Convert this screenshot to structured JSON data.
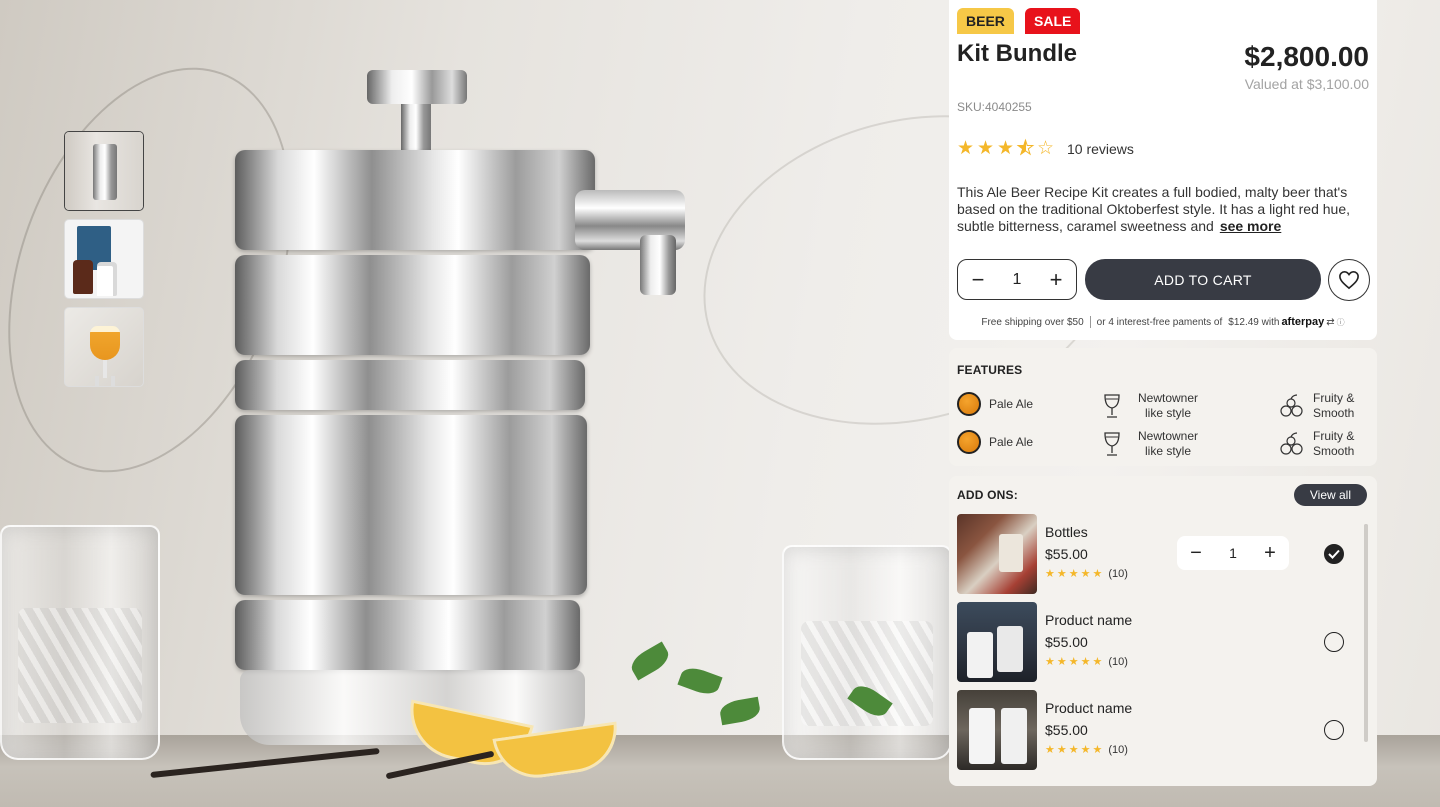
{
  "product": {
    "badges": [
      "BEER",
      "SALE"
    ],
    "title": "Kit Bundle",
    "price": "$2,800.00",
    "valued": "Valued at $3,100.00",
    "sku": "SKU:4040255",
    "rating_value": 3.5,
    "rating_max": 5,
    "reviews": "10 reviews",
    "description": "This Ale Beer Recipe Kit creates a full bodied, malty beer that's based on the traditional Oktoberfest style. It has a light red hue, subtle bitterness, caramel sweetness and",
    "see_more": "see more",
    "quantity": "1",
    "add_to_cart": "ADD TO CART",
    "shipping_free": "Free shipping over $50",
    "shipping_installments": "or 4 interest-free paments of",
    "installment_amount": "$12.49 with",
    "afterpay_label": "afterpay"
  },
  "features": {
    "heading": "FEATURES",
    "items": [
      {
        "label": "Pale Ale",
        "icon": "pale-ale-color-swatch"
      },
      {
        "label": "Newtowner like style",
        "icon": "glass-icon"
      },
      {
        "label": "Fruity & Smooth",
        "icon": "fruit-icon"
      },
      {
        "label": "Pale Ale",
        "icon": "pale-ale-color-swatch"
      },
      {
        "label": "Newtowner like style",
        "icon": "glass-icon"
      },
      {
        "label": "Fruity & Smooth",
        "icon": "fruit-icon"
      }
    ]
  },
  "addons": {
    "heading": "ADD ONS:",
    "view_all": "View all",
    "items": [
      {
        "name": "Bottles",
        "price": "$55.00",
        "rating": 5,
        "count": "(10)",
        "quantity": "1",
        "selected": true
      },
      {
        "name": "Product name",
        "price": "$55.00",
        "rating": 5,
        "count": "(10)",
        "selected": false
      },
      {
        "name": "Product name",
        "price": "$55.00",
        "rating": 5,
        "count": "(10)",
        "selected": false
      }
    ]
  },
  "gallery": {
    "thumbnails": [
      "brewer-kit-photo",
      "brewery-kit-box-photo",
      "beer-glass-photo"
    ],
    "active_index": 0
  },
  "colors": {
    "badge_beer": "#f6c847",
    "badge_sale": "#e8121b",
    "button_dark": "#383b44",
    "star": "#f4b72a"
  }
}
